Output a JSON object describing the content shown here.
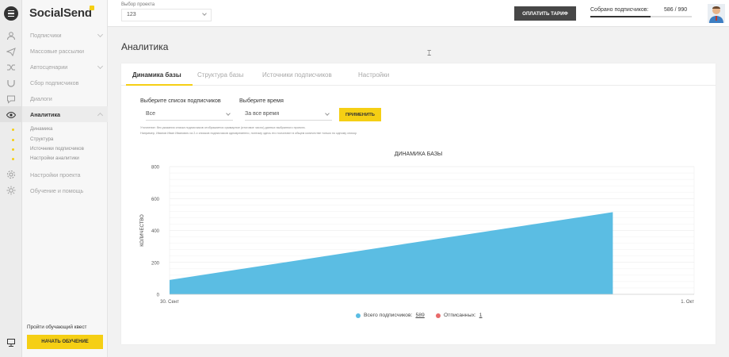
{
  "app": {
    "logo": "SocialSend"
  },
  "sidebar": {
    "items": [
      {
        "label": "Подписчики",
        "has_chevron": true
      },
      {
        "label": "Массовые рассылки",
        "has_chevron": false
      },
      {
        "label": "Автосценарии",
        "has_chevron": true
      },
      {
        "label": "Сбор подписчиков",
        "has_chevron": false
      },
      {
        "label": "Диалоги",
        "has_chevron": false
      },
      {
        "label": "Аналитика",
        "has_chevron": true,
        "active": true
      },
      {
        "label": "Настройки проекта",
        "has_chevron": false
      },
      {
        "label": "Обучение и помощь",
        "has_chevron": false
      }
    ],
    "sub_items": [
      "Динамика",
      "Структура",
      "Источники подписчиков",
      "Настройки аналитики"
    ],
    "quest_label": "Пройти обучающий квест",
    "quest_button": "НАЧАТЬ ОБУЧЕНИЕ"
  },
  "topbar": {
    "project_label": "Выбор проекта",
    "project_value": "123",
    "pay_button": "ОПЛАТИТЬ ТАРИФ",
    "subscribers_label": "Собрано подписчиков:",
    "subscribers_count": "586 / 990",
    "subscribers_progress": 0.592
  },
  "page": {
    "title": "Аналитика"
  },
  "tabs": [
    {
      "label": "Динамика базы",
      "active": true
    },
    {
      "label": "Структура базы",
      "active": false
    },
    {
      "label": "Источники подписчиков",
      "active": false
    },
    {
      "label": "Настройки",
      "active": false
    }
  ],
  "filters": {
    "list_label": "Выберите список подписчиков",
    "list_value": "Все",
    "time_label": "Выберите время",
    "time_value": "За все время",
    "apply_button": "ПРИМЕНИТЬ",
    "note_line1": "Уточнение: без указания списка подписчиков отображается суммарное (итоговое число) данных выбранного проекта.",
    "note_line2": "Например, Иванов Иван Иванович из 2-х списков подписчиков одновременно, поэтому здесь его посчитают в общем количестве только по одному списку."
  },
  "colors": {
    "accent": "#f5cf14",
    "series_total": "#5bbde3",
    "series_unsub": "#e86a6a"
  },
  "chart_data": {
    "type": "area",
    "title": "ДИНАМИКА БАЗЫ",
    "xlabel": "",
    "ylabel": "КОЛИЧЕСТВО",
    "x_ticks": [
      "30. Сент",
      "1. Окт"
    ],
    "y_ticks": [
      0,
      200,
      400,
      600,
      800
    ],
    "ylim": [
      0,
      800
    ],
    "series": [
      {
        "name": "Всего подписчиков",
        "x": [
          "30. Сент",
          "1. Окт"
        ],
        "values": [
          90,
          515
        ]
      }
    ],
    "legend": [
      {
        "name": "Всего подписчиков:",
        "value": "589"
      },
      {
        "name": "Отписанных:",
        "value": "1"
      }
    ],
    "grid": true,
    "legend_position": "bottom"
  }
}
